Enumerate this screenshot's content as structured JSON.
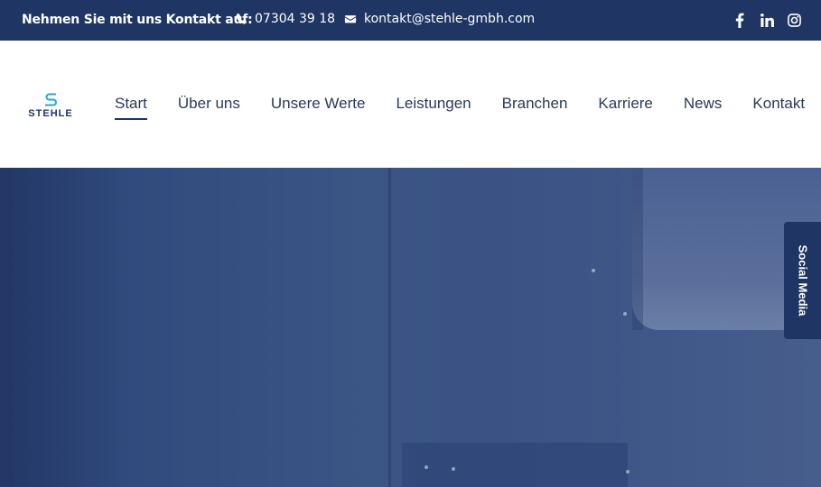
{
  "topbar": {
    "intro": "Nehmen Sie mit uns Kontakt auf:",
    "phone": "07304 39 18",
    "email": "kontakt@stehle-gmbh.com",
    "social_icons": [
      "facebook-icon",
      "linkedin-icon",
      "instagram-icon"
    ]
  },
  "logo": {
    "text": "STEHLE"
  },
  "nav": {
    "items": [
      "Start",
      "Über uns",
      "Unsere Werte",
      "Leistungen",
      "Branchen",
      "Karriere",
      "News",
      "Kontakt"
    ],
    "active": "Start"
  },
  "social_tab": {
    "label": "Social Media"
  },
  "colors": {
    "brand_navy": "#1f3563",
    "logo_accent": "#29a3d8",
    "nav_text": "#2a3a55"
  }
}
